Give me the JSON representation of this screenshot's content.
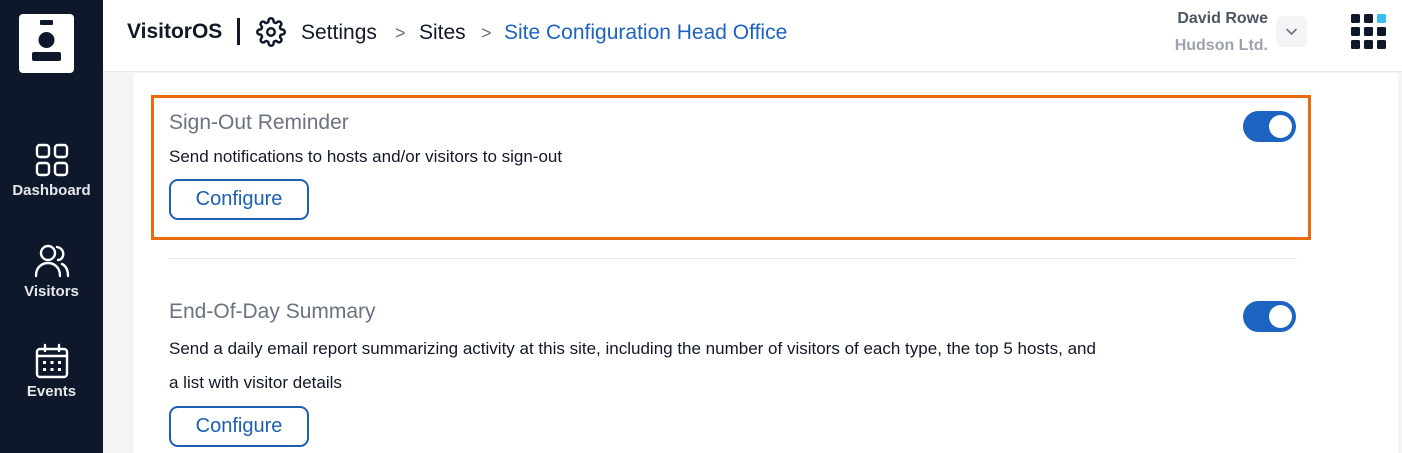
{
  "app": {
    "brand": "VisitorOS",
    "accent_color": "#1d63c1",
    "highlight_color": "#ea6a0c",
    "sidebar_bg": "#0f172a"
  },
  "sidebar": {
    "logo_icon": "id-badge-icon",
    "items": [
      {
        "label": "Dashboard",
        "icon": "dashboard-grid-icon"
      },
      {
        "label": "Visitors",
        "icon": "users-icon"
      },
      {
        "label": "Events",
        "icon": "calendar-icon"
      }
    ]
  },
  "header": {
    "breadcrumb": {
      "settings_icon": "gear-icon",
      "items": [
        "Settings",
        "Sites",
        "Site Configuration Head Office"
      ],
      "separator": ">"
    },
    "user": {
      "name": "David Rowe",
      "org": "Hudson Ltd.",
      "dropdown_icon": "chevron-down-icon"
    },
    "apps_icon": "apps-grid-icon"
  },
  "settings": [
    {
      "title": "Sign-Out Reminder",
      "description": "Send notifications to hosts and/or visitors to sign-out",
      "button": "Configure",
      "enabled": true,
      "highlighted": true
    },
    {
      "title": "End-Of-Day Summary",
      "description_line1": "Send a daily email report summarizing activity at this site, including the number of visitors of each type, the top 5 hosts, and",
      "description_line2": "a list with visitor details",
      "button": "Configure",
      "enabled": true,
      "highlighted": false
    }
  ]
}
